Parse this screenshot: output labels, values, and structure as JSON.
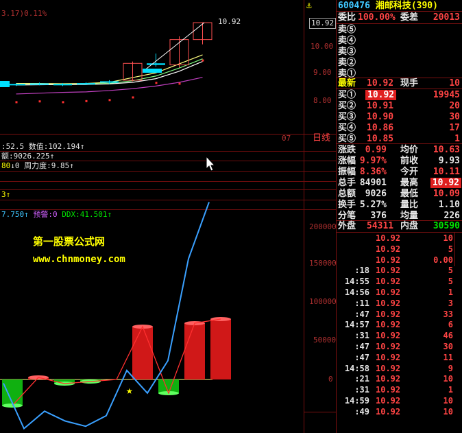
{
  "header": {
    "top_left_partial": "3.17)0.11%",
    "stock_code": "600476",
    "stock_name": "湘邮科技",
    "stock_count": "(390)"
  },
  "colors": {
    "up": "#ff4444",
    "down": "#00e400",
    "neutral": "#e6e6e6",
    "accent": "#ffff00",
    "highlight_bg": "#e02020"
  },
  "price_axis": [
    "10.92",
    "10.00",
    "9.00",
    "8.00"
  ],
  "price_chart": {
    "last_label": "10.92",
    "day_line_label": "日线",
    "tick_07": "07",
    "candles_days": [
      {
        "o": 8.58,
        "h": 8.62,
        "l": 8.52,
        "c": 8.6
      },
      {
        "o": 8.6,
        "h": 8.65,
        "l": 8.55,
        "c": 8.62
      },
      {
        "o": 8.58,
        "h": 8.63,
        "l": 8.52,
        "c": 8.6
      },
      {
        "o": 8.62,
        "h": 8.66,
        "l": 8.56,
        "c": 8.63
      },
      {
        "o": 8.66,
        "h": 8.74,
        "l": 8.6,
        "c": 8.7
      },
      {
        "o": 8.74,
        "h": 9.45,
        "l": 8.7,
        "c": 9.38
      },
      {
        "o": 9.38,
        "h": 9.75,
        "l": 9.25,
        "c": 9.32
      },
      {
        "o": 9.32,
        "h": 10.4,
        "l": 9.22,
        "c": 10.28
      },
      {
        "o": 10.28,
        "h": 10.92,
        "l": 10.1,
        "c": 10.92
      }
    ]
  },
  "indicators": {
    "line1": ":52.5 数值:102.194↑",
    "line2": "额:9026.225↑",
    "line3_a": "80",
    "line3_b": "↓0 周力度:9.85↑",
    "line4": "3↑",
    "line5_a": "7.750↑",
    "line5_b": "预警:0",
    "line5_c": "DDX:41.501↑"
  },
  "watermark": {
    "line1": "第一股票公式网",
    "line2": "www.chnmoney.com"
  },
  "volume_axis": [
    "200000",
    "150000",
    "100000",
    "50000",
    "0"
  ],
  "volume_chart": {
    "bars": [
      -38,
      3,
      -6,
      -3,
      0,
      77,
      -20,
      82,
      88
    ],
    "line": [
      -5,
      -65,
      -42,
      -55,
      -62,
      -48,
      12,
      -18,
      25,
      160,
      235
    ],
    "star": "★"
  },
  "quote": {
    "weibi_label": "委比",
    "weibi_value": "100.00%",
    "weicha_label": "委差",
    "weicha_value": "20013",
    "sells": [
      {
        "label": "卖⑤",
        "price": "",
        "vol": ""
      },
      {
        "label": "卖④",
        "price": "",
        "vol": ""
      },
      {
        "label": "卖③",
        "price": "",
        "vol": ""
      },
      {
        "label": "卖②",
        "price": "",
        "vol": ""
      },
      {
        "label": "卖①",
        "price": "",
        "vol": ""
      }
    ],
    "latest_label": "最新",
    "latest_value": "10.92",
    "xianshou_label": "现手",
    "xianshou_value": "10",
    "buys": [
      {
        "label": "买①",
        "price": "10.92",
        "vol": "19945"
      },
      {
        "label": "买②",
        "price": "10.91",
        "vol": "20"
      },
      {
        "label": "买③",
        "price": "10.90",
        "vol": "30"
      },
      {
        "label": "买④",
        "price": "10.86",
        "vol": "17"
      },
      {
        "label": "买⑤",
        "price": "10.85",
        "vol": "1"
      }
    ],
    "stats": [
      {
        "l1": "涨跌",
        "v1": "0.99",
        "l2": "均价",
        "v2": "10.63"
      },
      {
        "l1": "涨幅",
        "v1": "9.97%",
        "l2": "前收",
        "v2": "9.93"
      },
      {
        "l1": "振幅",
        "v1": "8.36%",
        "l2": "今开",
        "v2": "10.11"
      },
      {
        "l1": "总手",
        "v1": "84901",
        "l2": "最高",
        "v2": "10.92"
      },
      {
        "l1": "总额",
        "v1": "9026",
        "l2": "最低",
        "v2": "10.09"
      },
      {
        "l1": "换手",
        "v1": "5.27%",
        "l2": "量比",
        "v2": "1.10"
      },
      {
        "l1": "分笔",
        "v1": "376",
        "l2": "均量",
        "v2": "226"
      }
    ],
    "waipan_label": "外盘",
    "waipan_value": "54311",
    "neipan_label": "内盘",
    "neipan_value": "30590"
  },
  "ticks": [
    {
      "time": "",
      "price": "10.92",
      "vol": "10"
    },
    {
      "time": "",
      "price": "10.92",
      "vol": "5"
    },
    {
      "time": "",
      "price": "10.92",
      "vol": "0.00"
    },
    {
      "time": ":18",
      "price": "10.92",
      "vol": "5"
    },
    {
      "time": "14:55",
      "price": "10.92",
      "vol": "5"
    },
    {
      "time": "14:56",
      "price": "10.92",
      "vol": "1"
    },
    {
      "time": ":11",
      "price": "10.92",
      "vol": "3"
    },
    {
      "time": ":47",
      "price": "10.92",
      "vol": "33"
    },
    {
      "time": "14:57",
      "price": "10.92",
      "vol": "6"
    },
    {
      "time": ":31",
      "price": "10.92",
      "vol": "46"
    },
    {
      "time": ":47",
      "price": "10.92",
      "vol": "30"
    },
    {
      "time": ":47",
      "price": "10.92",
      "vol": "11"
    },
    {
      "time": "14:58",
      "price": "10.92",
      "vol": "9"
    },
    {
      "time": ":21",
      "price": "10.92",
      "vol": "10"
    },
    {
      "time": ":31",
      "price": "10.92",
      "vol": "1"
    },
    {
      "time": "14:59",
      "price": "10.92",
      "vol": "10"
    },
    {
      "time": ":49",
      "price": "10.92",
      "vol": "10"
    }
  ]
}
